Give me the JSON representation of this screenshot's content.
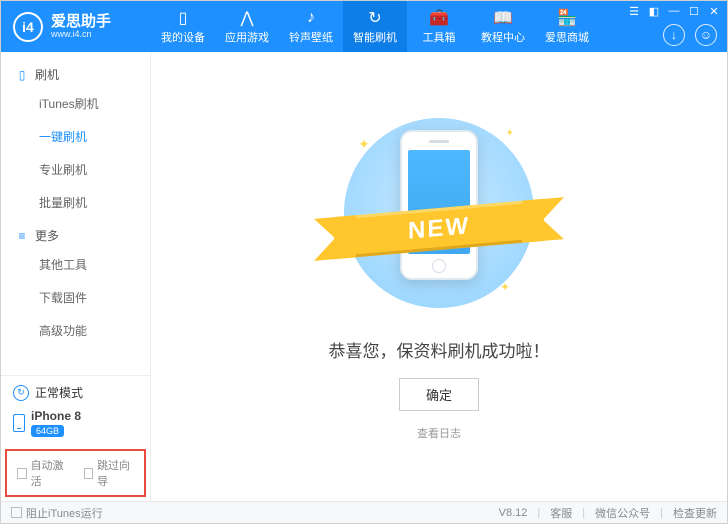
{
  "brand": {
    "name": "爱思助手",
    "sub": "www.i4.cn",
    "logo_text": "i4"
  },
  "nav": {
    "items": [
      {
        "label": "我的设备"
      },
      {
        "label": "应用游戏"
      },
      {
        "label": "铃声壁纸"
      },
      {
        "label": "智能刷机"
      },
      {
        "label": "工具箱"
      },
      {
        "label": "教程中心"
      },
      {
        "label": "爱思商城"
      }
    ],
    "active_index": 3
  },
  "sidebar": {
    "group1": {
      "title": "刷机",
      "items": [
        "iTunes刷机",
        "一键刷机",
        "专业刷机",
        "批量刷机"
      ],
      "selected_index": 1
    },
    "group2": {
      "title": "更多",
      "items": [
        "其他工具",
        "下载固件",
        "高级功能"
      ]
    },
    "mode_label": "正常模式",
    "device_name": "iPhone 8",
    "device_storage": "64GB",
    "check1": "自动激活",
    "check2": "跳过向导"
  },
  "content": {
    "ribbon_text": "NEW",
    "message": "恭喜您，保资料刷机成功啦！",
    "ok_label": "确定",
    "log_link": "查看日志"
  },
  "statusbar": {
    "block_itunes": "阻止iTunes运行",
    "version": "V8.12",
    "support": "客服",
    "wechat": "微信公众号",
    "update": "检查更新"
  }
}
